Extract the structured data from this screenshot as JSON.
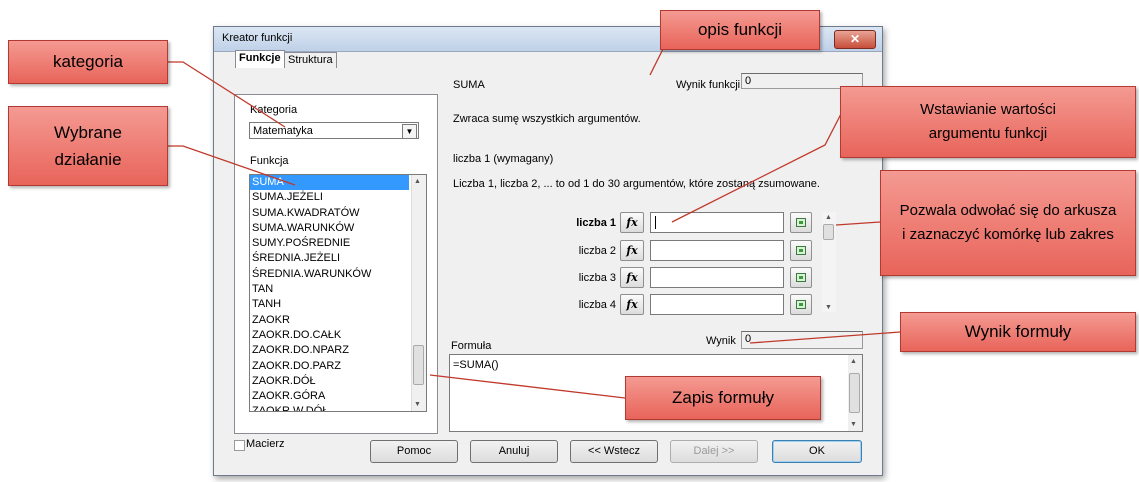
{
  "dialog": {
    "title": "Kreator funkcji",
    "close_icon": "close-icon",
    "tabs": [
      {
        "label": "Funkcje"
      },
      {
        "label": "Struktura"
      }
    ],
    "category_label": "Kategoria",
    "category_value": "Matematyka",
    "function_label": "Funkcja",
    "functions": [
      "SUMA",
      "SUMA.JEŻELI",
      "SUMA.KWADRATÓW",
      "SUMA.WARUNKÓW",
      "SUMY.POŚREDNIE",
      "ŚREDNIA.JEŻELI",
      "ŚREDNIA.WARUNKÓW",
      "TAN",
      "TANH",
      "ZAOKR",
      "ZAOKR.DO.CAŁK",
      "ZAOKR.DO.NPARZ",
      "ZAOKR.DO.PARZ",
      "ZAOKR.DÓŁ",
      "ZAOKR.GÓRA",
      "ZAOKR.W.DÓŁ"
    ],
    "selected_function": "SUMA",
    "array_label": "Macierz",
    "function_name": "SUMA",
    "function_result_label": "Wynik funkcji",
    "function_result_value": "0",
    "description": "Zwraca sumę wszystkich argumentów.",
    "arg_required": "liczba 1 (wymagany)",
    "arg_description": "Liczba 1, liczba 2, ... to od 1 do 30 argumentów, które zostaną zsumowane.",
    "args": [
      {
        "label": "liczba 1",
        "value": ""
      },
      {
        "label": "liczba 2",
        "value": ""
      },
      {
        "label": "liczba 3",
        "value": ""
      },
      {
        "label": "liczba 4",
        "value": ""
      }
    ],
    "fx_label": "fx",
    "result_label": "Wynik",
    "result_value": "0",
    "formula_label": "Formuła",
    "formula_value": "=SUMA()",
    "buttons": {
      "help": "Pomoc",
      "cancel": "Anuluj",
      "back": "<< Wstecz",
      "next": "Dalej >>",
      "ok": "OK"
    }
  },
  "annotations": {
    "kategoria": "kategoria",
    "wybrane_dzialanie": "Wybrane działanie",
    "opis_funkcji": "opis funkcji",
    "wstawianie": "Wstawianie wartości argumentu funkcji",
    "pozwala": "Pozwala odwołać się do arkusza i zaznaczyć komórkę lub zakres",
    "wynik_formuly": "Wynik formuły",
    "zapis_formuly": "Zapis formuły"
  },
  "colors": {
    "callout_fill": "#ec7b72",
    "callout_border": "#b23a33",
    "selection": "#3399ff"
  }
}
